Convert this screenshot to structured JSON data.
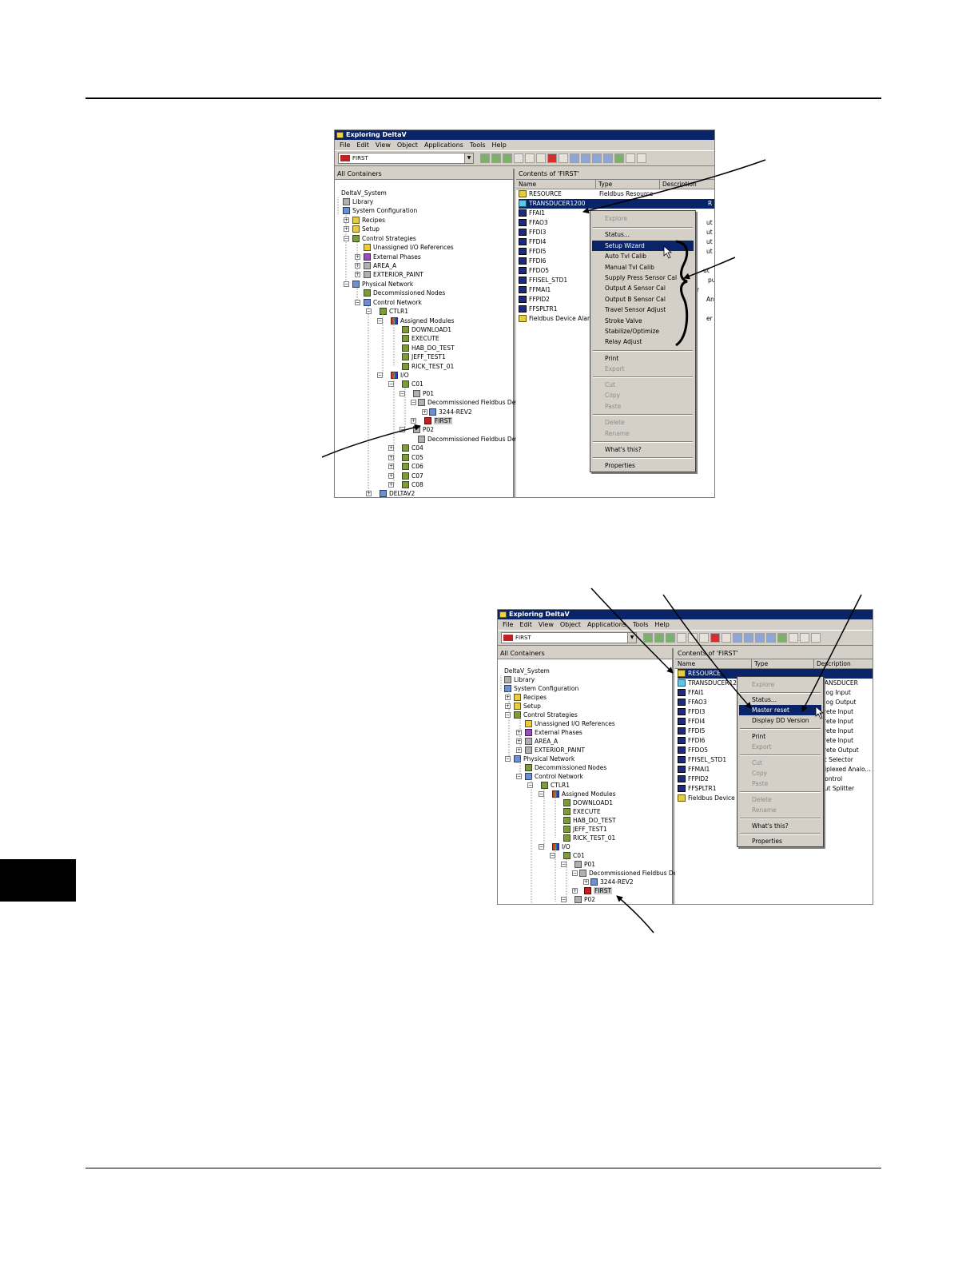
{
  "window_title": "Exploring DeltaV",
  "menu": [
    "File",
    "Edit",
    "View",
    "Object",
    "Applications",
    "Tools",
    "Help"
  ],
  "combo_value": "FIRST",
  "left_header": "All Containers",
  "right_header": "Contents of 'FIRST'",
  "columns": {
    "name": "Name",
    "type": "Type",
    "description": "Description"
  },
  "tree": {
    "root": "DeltaV_System",
    "library": "Library",
    "system_configuration": "System Configuration",
    "recipes": "Recipes",
    "setup": "Setup",
    "control_strategies": "Control Strategies",
    "unassigned": "Unassigned I/O References",
    "external_phases": "External Phases",
    "area_a": "AREA_A",
    "exterior_paint": "EXTERIOR_PAINT",
    "physical_network": "Physical Network",
    "decommissioned_nodes": "Decommissioned Nodes",
    "control_network": "Control Network",
    "ctlr1": "CTLR1",
    "assigned_modules": "Assigned Modules",
    "download1": "DOWNLOAD1",
    "execute": "EXECUTE",
    "hab_do_test": "HAB_DO_TEST",
    "jeff_test1": "JEFF_TEST1",
    "rick_test_01": "RICK_TEST_01",
    "io": "I/O",
    "c01": "C01",
    "p01": "P01",
    "decommissioned_fieldbus": "Decommissioned Fieldbus Devi",
    "rev2": "3244-REV2",
    "first": "FIRST",
    "p02": "P02",
    "c04": "C04",
    "c05": "C05",
    "c06": "C06",
    "c07": "C07",
    "c08": "C08",
    "deltav2": "DELTAV2"
  },
  "contents1": [
    "RESOURCE",
    "TRANSDUCER1200",
    "FFAI1",
    "FFAO3",
    "FFDI3",
    "FFDI4",
    "FFDI5",
    "FFDI6",
    "FFDO5",
    "FFISEL_STD1",
    "FFMAI1",
    "FFPID2",
    "FFSPLTR1",
    "Fieldbus Device Alarms"
  ],
  "types1": [
    "Fieldbus Resource",
    "R",
    "ut",
    "ut",
    "ut",
    "ut",
    "ut",
    "put",
    "r",
    "Analo...",
    "",
    "er"
  ],
  "menu1": {
    "explore": "Explore",
    "status": "Status...",
    "setup_wizard": "Setup Wizard",
    "auto_tvl_calib": "Auto Tvl Calib",
    "manual_tvl_calib": "Manual Tvl Calib",
    "supply_press": "Supply Press Sensor Cal",
    "output_a": "Output A Sensor Cal",
    "output_b": "Output B Sensor Cal",
    "travel_sensor": "Travel Sensor Adjust",
    "stroke_valve": "Stroke Valve",
    "stabilize": "Stabilize/Optimize",
    "relay_adjust": "Relay Adjust",
    "print": "Print",
    "export": "Export",
    "cut": "Cut",
    "copy": "Copy",
    "paste": "Paste",
    "delete": "Delete",
    "rename": "Rename",
    "whats_this": "What's this?",
    "properties": "Properties"
  },
  "contents2": [
    "RESOURCE",
    "TRANSDUCER1200",
    "FFAI1",
    "FFAO3",
    "FFDI3",
    "FFDI4",
    "FFDI5",
    "FFDI6",
    "FFDO5",
    "FFISEL_STD1",
    "FFMAI1",
    "FFPID2",
    "FFSPLTR1",
    "Fieldbus Device Ala"
  ],
  "types2": [
    "RANSDUCER",
    "alog Input",
    "alog Output",
    "crete Input",
    "crete Input",
    "crete Input",
    "crete Input",
    "crete Output",
    "ut Selector",
    "ltiplexed Analo...",
    "Control",
    "put Splitter"
  ],
  "menu2": {
    "explore": "Explore",
    "status": "Status...",
    "master_reset": "Master reset",
    "display_dd": "Display DD Version",
    "print": "Print",
    "export": "Export",
    "cut": "Cut",
    "copy": "Copy",
    "paste": "Paste",
    "delete": "Delete",
    "rename": "Rename",
    "whats_this": "What's this?",
    "properties": "Properties"
  }
}
